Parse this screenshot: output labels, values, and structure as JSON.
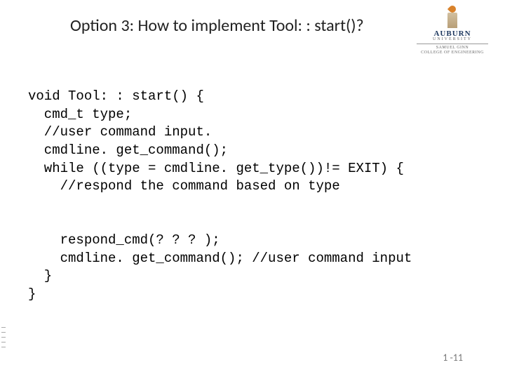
{
  "title": "Option 3: How to implement Tool: : start()?",
  "logo": {
    "name": "AUBURN",
    "sub": "UNIVERSITY",
    "college_line1": "SAMUEL GINN",
    "college_line2": "COLLEGE OF ENGINEERING"
  },
  "code": {
    "l1": "void Tool: : start() {",
    "l2": "  cmd_t type;",
    "l3": "  //user command input.",
    "l4": "  cmdline. get_command();",
    "l5": "  while ((type = cmdline. get_type())!= EXIT) {",
    "l6": "    //respond the command based on type",
    "l7": "",
    "l8": "",
    "l9": "    respond_cmd(? ? ? );",
    "l10": "    cmdline. get_command(); //user command input",
    "l11": "  }",
    "l12": "}"
  },
  "page_number": "1 -11"
}
